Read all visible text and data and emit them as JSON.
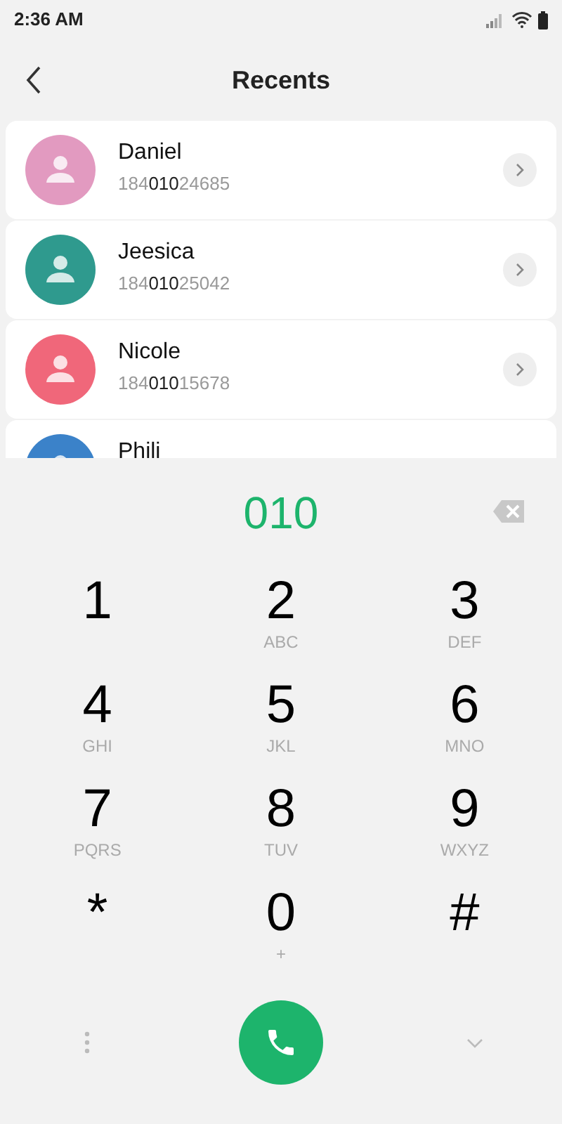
{
  "status_bar": {
    "time": "2:36 AM"
  },
  "header": {
    "title": "Recents"
  },
  "contacts": [
    {
      "name": "Daniel",
      "number": "184**010**24685",
      "color": "#e29ac0"
    },
    {
      "name": "Jeesica",
      "number": "184**010**25042",
      "color": "#2f9a8e"
    },
    {
      "name": "Nicole",
      "number": "184**010**15678",
      "color": "#f0677a"
    },
    {
      "name": "Phili",
      "color": "#3b82c9"
    }
  ],
  "dialer": {
    "input": "010",
    "keys": [
      {
        "digit": "1"
      },
      {
        "digit": "2",
        "letters": "ABC"
      },
      {
        "digit": "3",
        "letters": "DEF"
      },
      {
        "digit": "4",
        "letters": "GHI"
      },
      {
        "digit": "5",
        "letters": "JKL"
      },
      {
        "digit": "6",
        "letters": "MNO"
      },
      {
        "digit": "7",
        "letters": "PQRS"
      },
      {
        "digit": "8",
        "letters": "TUV"
      },
      {
        "digit": "9",
        "letters": "WXYZ"
      },
      {
        "digit": "*"
      },
      {
        "digit": "0",
        "letters": "+"
      },
      {
        "digit": "#"
      }
    ]
  }
}
